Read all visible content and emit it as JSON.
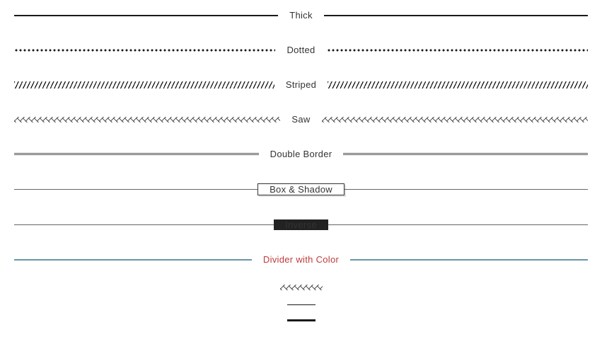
{
  "dividers": {
    "thick": {
      "label": "Thick"
    },
    "dotted": {
      "label": "Dotted"
    },
    "striped": {
      "label": "Striped"
    },
    "saw": {
      "label": "Saw"
    },
    "double": {
      "label": "Double Border"
    },
    "box": {
      "label": "Box & Shadow"
    },
    "inverse": {
      "label": "Inverse"
    },
    "color": {
      "label": "Divider with Color",
      "line_color": "#6a95aa",
      "label_color": "#c03a3a"
    }
  }
}
